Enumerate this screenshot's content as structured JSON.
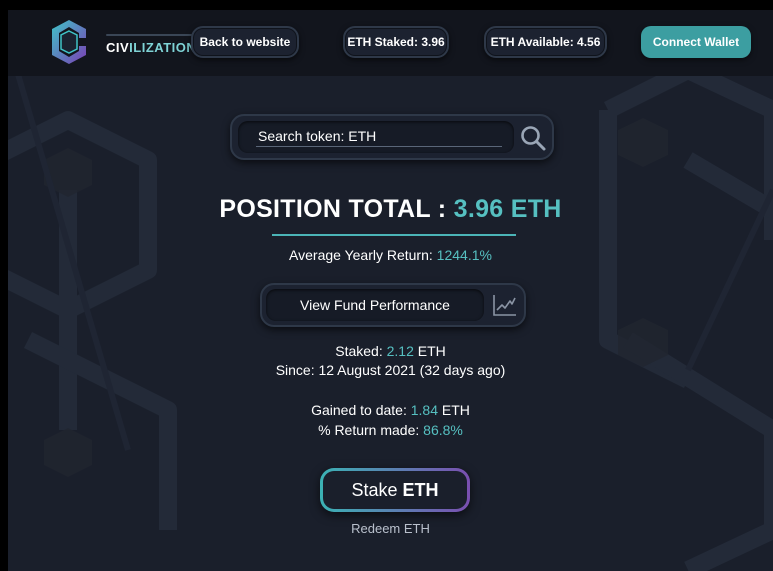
{
  "header": {
    "logo_text_bold": "CIV",
    "logo_text_rest": "ILIZATION",
    "back_label": "Back to website",
    "eth_staked_label": "ETH Staked: 3.96",
    "eth_available_label": "ETH Available: 4.56",
    "connect_label": "Connect Wallet"
  },
  "search": {
    "text": "Search token: ETH"
  },
  "position": {
    "label": "POSITION TOTAL :",
    "value": "3.96 ETH"
  },
  "average_return": {
    "label": "Average Yearly Return:",
    "value": "1244.1%"
  },
  "fund_performance_label": "View Fund Performance",
  "staked": {
    "label": "Staked:",
    "value": "2.12",
    "unit": "ETH",
    "since": "Since: 12 August 2021 (32 days ago)"
  },
  "gains": {
    "label": "Gained to date:",
    "value": "1.84",
    "unit": "ETH",
    "return_label": "% Return made:",
    "return_value": "86.8%"
  },
  "stake_button": {
    "word1": "Stake",
    "word2": "ETH"
  },
  "redeem_label": "Redeem ETH",
  "colors": {
    "accent": "#56c0c1",
    "button_teal": "#3c9ea1",
    "background": "#1a1f2b",
    "header": "#12151d"
  },
  "icons": [
    "logo-hex-icon",
    "search-icon",
    "chart-line-icon"
  ]
}
